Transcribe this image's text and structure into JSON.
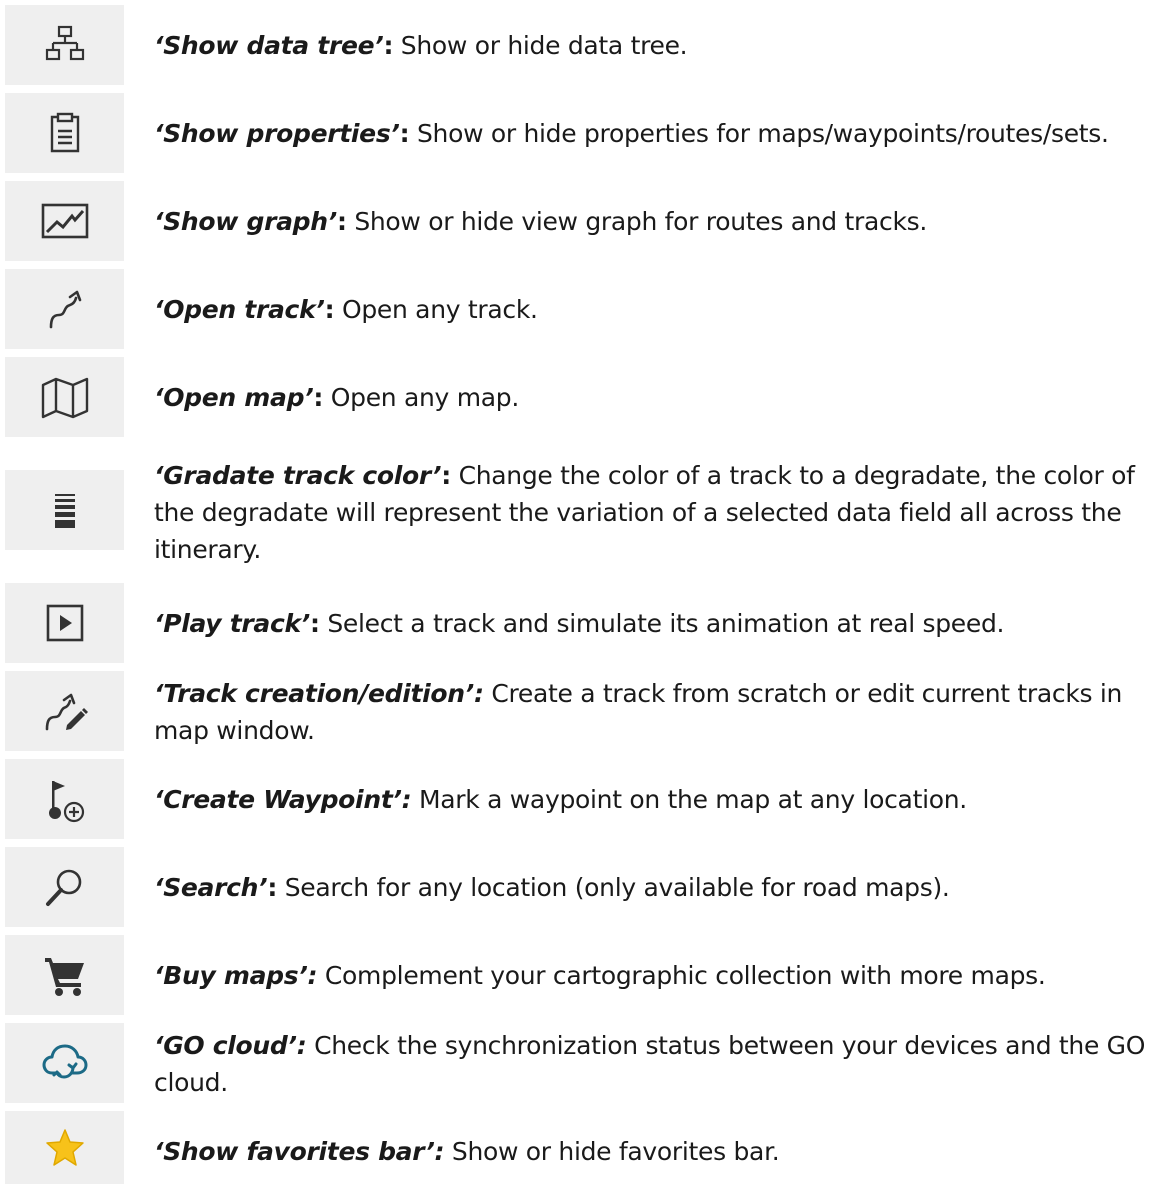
{
  "items": [
    {
      "icon": "data-tree-icon",
      "term": "‘Show data tree’",
      "colon": ":",
      "text": " Show or hide data tree."
    },
    {
      "icon": "clipboard-icon",
      "term": "‘Show properties’",
      "colon": ":",
      "text": " Show or hide properties for maps/waypoints/routes/sets."
    },
    {
      "icon": "graph-icon",
      "term": "‘Show graph’",
      "colon": ":",
      "text": " Show or hide view graph for routes and tracks."
    },
    {
      "icon": "open-track-icon",
      "term": "‘Open track’",
      "colon": ":",
      "text": " Open any track."
    },
    {
      "icon": "map-icon",
      "term": "‘Open map’",
      "colon": ":",
      "text": " Open any map."
    },
    {
      "icon": "gradient-bars-icon",
      "term": "‘Gradate track color’",
      "colon": ":",
      "text": " Change the color of a track to a degradate, the color of the degradate will represent the variation of a selected data field all across the itinerary."
    },
    {
      "icon": "play-icon",
      "term": "‘Play track’",
      "colon": ":",
      "text": " Select a track and simulate its animation at real speed."
    },
    {
      "icon": "track-edit-icon",
      "term": "‘Track creation/edition’:",
      "colon": "",
      "text": " Create a track from scratch or edit current tracks in map window."
    },
    {
      "icon": "create-waypoint-icon",
      "term": "‘Create Waypoint’:",
      "colon": "",
      "text": " Mark a waypoint on the map at any location."
    },
    {
      "icon": "search-icon",
      "term": "‘Search’",
      "colon": ":",
      "text": " Search for any location (only available for road maps)."
    },
    {
      "icon": "cart-icon",
      "term": "‘Buy maps’:",
      "colon": "",
      "text": " Complement your cartographic collection with more maps."
    },
    {
      "icon": "cloud-sync-icon",
      "term": "‘GO cloud’:",
      "colon": "",
      "text": " Check the synchronization status between your devices and the GO cloud."
    },
    {
      "icon": "star-icon",
      "term": "‘Show favorites bar’:",
      "colon": "",
      "text": " Show or hide favorites bar."
    }
  ],
  "colors": {
    "tile": "#efefef",
    "icon": "#333333",
    "cloud": "#1c6a86",
    "star": "#f7c21a"
  }
}
